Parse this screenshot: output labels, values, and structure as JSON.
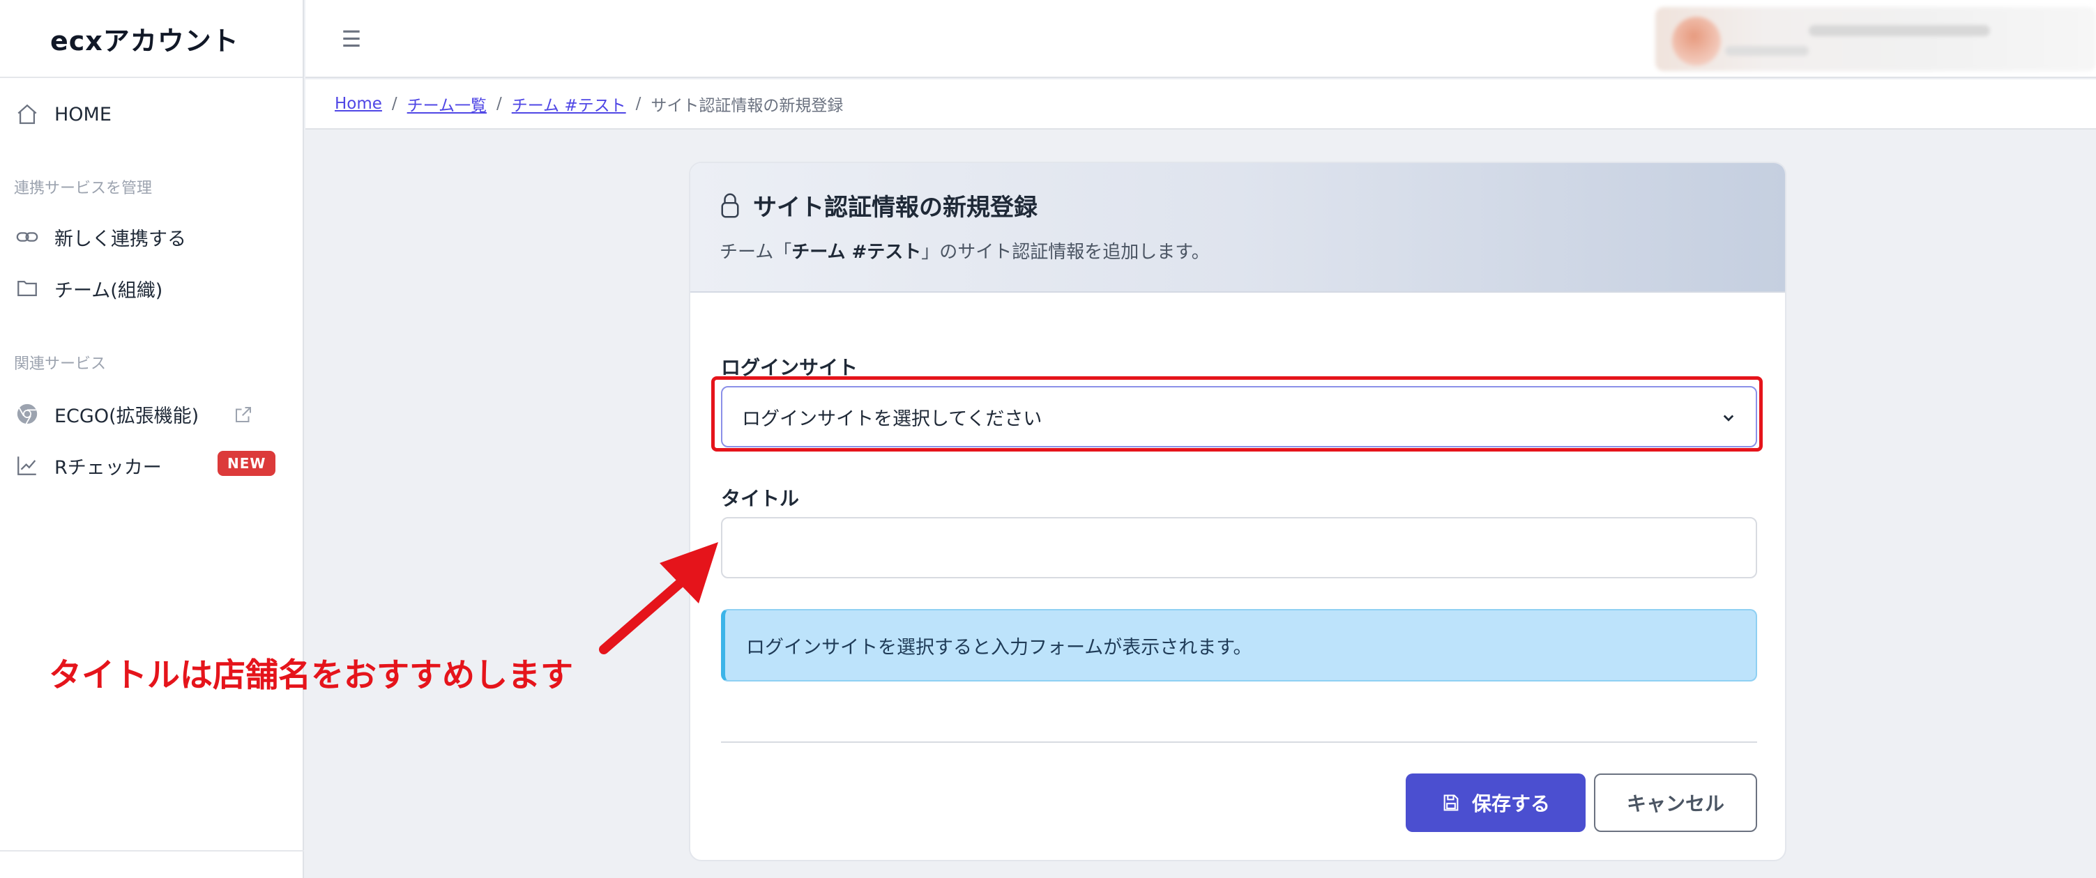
{
  "brand": {
    "logo_text": "ecxアカウント"
  },
  "sidebar": {
    "home_label": "HOME",
    "section_manage": "連携サービスを管理",
    "new_link_label": "新しく連携する",
    "team_label": "チーム(組織)",
    "section_related": "関連サービス",
    "ecgo_label": "ECGO(拡張機能)",
    "rchecker_label": "Rチェッカー",
    "rchecker_badge": "NEW"
  },
  "topbar": {
    "menu_icon": "hamburger-icon"
  },
  "breadcrumb": {
    "home": "Home",
    "teams": "チーム一覧",
    "team": "チーム #テスト",
    "current": "サイト認証情報の新規登録",
    "separator": "/"
  },
  "card": {
    "title": "サイト認証情報の新規登録",
    "subtitle_prefix": "チーム「",
    "subtitle_team": "チーム #テスト",
    "subtitle_suffix": "」のサイト認証情報を追加します。"
  },
  "form": {
    "login_site_label": "ログインサイト",
    "login_site_selected": "ログインサイトを選択してください",
    "title_label": "タイトル",
    "title_value": "",
    "info_message": "ログインサイトを選択すると入力フォームが表示されます。",
    "save_label": "保存する",
    "cancel_label": "キャンセル"
  },
  "annotation": {
    "text": "タイトルは店舗名をおすすめします",
    "color": "#e5141b"
  },
  "colors": {
    "primary": "#4b4fd0",
    "link": "#4f46e5",
    "badge": "#dc3a3a",
    "info_bg": "#bde3fb"
  }
}
